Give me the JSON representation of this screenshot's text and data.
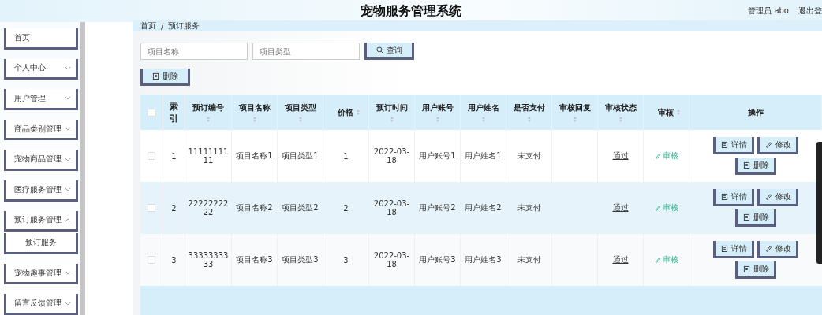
{
  "header": {
    "title": "宠物服务管理系统",
    "user": "管理员 abo",
    "logout": "退出登"
  },
  "sidebar": {
    "items": [
      {
        "label": "首页",
        "kind": "link"
      },
      {
        "label": "个人中心",
        "kind": "menu",
        "expanded": false
      },
      {
        "label": "用户管理",
        "kind": "menu",
        "expanded": false
      },
      {
        "label": "商品类别管理",
        "kind": "menu",
        "expanded": false
      },
      {
        "label": "宠物商品管理",
        "kind": "menu",
        "expanded": false
      },
      {
        "label": "医疗服务管理",
        "kind": "menu",
        "expanded": false
      },
      {
        "label": "预订服务管理",
        "kind": "menu",
        "expanded": true,
        "children": [
          {
            "label": "预订服务"
          }
        ]
      },
      {
        "label": "宠物趣事管理",
        "kind": "menu",
        "expanded": false
      },
      {
        "label": "留言反馈管理",
        "kind": "menu",
        "expanded": false
      }
    ]
  },
  "breadcrumb": [
    "首页",
    "预订服务"
  ],
  "breadcrumb_separator": "/",
  "search": {
    "fields": [
      {
        "placeholder": "项目名称"
      },
      {
        "placeholder": "项目类型"
      }
    ],
    "button": "查询"
  },
  "delete_button": "删除",
  "table": {
    "select_all_checked": false,
    "columns": [
      {
        "label": "索引",
        "sortable": false
      },
      {
        "label": "预订编号",
        "sortable": true
      },
      {
        "label": "项目名称",
        "sortable": true
      },
      {
        "label": "项目类型",
        "sortable": true
      },
      {
        "label": "价格",
        "sortable": true
      },
      {
        "label": "预订时间",
        "sortable": true
      },
      {
        "label": "用户账号",
        "sortable": true
      },
      {
        "label": "用户姓名",
        "sortable": true
      },
      {
        "label": "是否支付",
        "sortable": true
      },
      {
        "label": "审核回复",
        "sortable": true
      },
      {
        "label": "审核状态",
        "sortable": true
      },
      {
        "label": "审核",
        "sortable": true
      },
      {
        "label": "操作",
        "sortable": false
      }
    ],
    "rows": [
      {
        "checked": false,
        "cells": [
          "1",
          "1111111111",
          "项目名称1",
          "项目类型1",
          "1",
          "2022-03-18",
          "用户账号1",
          "用户姓名1",
          "未支付",
          "",
          "通过"
        ],
        "review": "审核",
        "actions": [
          "详情",
          "修改",
          "删除"
        ]
      },
      {
        "checked": false,
        "cells": [
          "2",
          "2222222222",
          "项目名称2",
          "项目类型2",
          "2",
          "2022-03-18",
          "用户账号2",
          "用户姓名2",
          "未支付",
          "",
          "通过"
        ],
        "review": "审核",
        "actions": [
          "详情",
          "修改",
          "删除"
        ]
      },
      {
        "checked": false,
        "cells": [
          "3",
          "3333333333",
          "项目名称3",
          "项目类型3",
          "3",
          "2022-03-18",
          "用户账号3",
          "用户姓名3",
          "未支付",
          "",
          "通过"
        ],
        "review": "审核",
        "actions": [
          "详情",
          "修改",
          "删除"
        ]
      }
    ]
  }
}
